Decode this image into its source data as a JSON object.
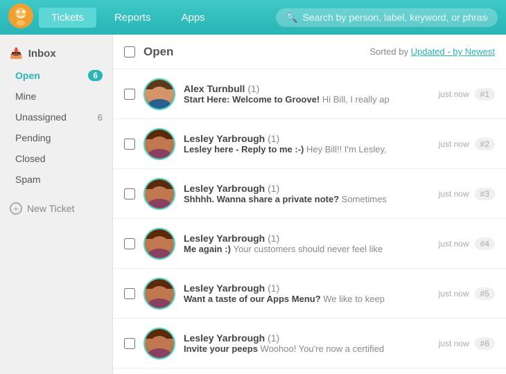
{
  "header": {
    "tickets_label": "Tickets",
    "reports_label": "Reports",
    "apps_label": "Apps",
    "search_placeholder": "Search by person, label, keyword, or phrase..."
  },
  "sidebar": {
    "inbox_label": "Inbox",
    "items": [
      {
        "id": "open",
        "label": "Open",
        "active": true,
        "badge": "6"
      },
      {
        "id": "mine",
        "label": "Mine",
        "active": false
      },
      {
        "id": "unassigned",
        "label": "Unassigned",
        "active": false,
        "count": "6"
      },
      {
        "id": "pending",
        "label": "Pending",
        "active": false
      },
      {
        "id": "closed",
        "label": "Closed",
        "active": false
      },
      {
        "id": "spam",
        "label": "Spam",
        "active": false
      }
    ],
    "new_ticket_label": "New Ticket"
  },
  "main": {
    "section_title": "Open",
    "sort_prefix": "Sorted by",
    "sort_link": "Updated - by Newest",
    "tickets": [
      {
        "id": 1,
        "sender": "Alex Turnbull",
        "count": "(1)",
        "subject": "Start Here: Welcome to Groove!",
        "preview": "Hi Bill, I really ap",
        "time": "just now",
        "num": "#1",
        "avatar_type": "alex"
      },
      {
        "id": 2,
        "sender": "Lesley Yarbrough",
        "count": "(1)",
        "subject": "Lesley here - Reply to me :-)",
        "preview": "Hey Bill!! I'm Lesley,",
        "time": "just now",
        "num": "#2",
        "avatar_type": "lesley"
      },
      {
        "id": 3,
        "sender": "Lesley Yarbrough",
        "count": "(1)",
        "subject": "Shhhh. Wanna share a private note?",
        "preview": "Sometimes",
        "time": "just now",
        "num": "#3",
        "avatar_type": "lesley"
      },
      {
        "id": 4,
        "sender": "Lesley Yarbrough",
        "count": "(1)",
        "subject": "Me again :)",
        "preview": "Your customers should never feel like",
        "time": "just now",
        "num": "#4",
        "avatar_type": "lesley"
      },
      {
        "id": 5,
        "sender": "Lesley Yarbrough",
        "count": "(1)",
        "subject": "Want a taste of our Apps Menu?",
        "preview": "We like to keep",
        "time": "just now",
        "num": "#5",
        "avatar_type": "lesley"
      },
      {
        "id": 6,
        "sender": "Lesley Yarbrough",
        "count": "(1)",
        "subject": "Invite your peeps",
        "preview": "Woohoo! You're now a certified",
        "time": "just now",
        "num": "#6",
        "avatar_type": "lesley"
      }
    ]
  }
}
